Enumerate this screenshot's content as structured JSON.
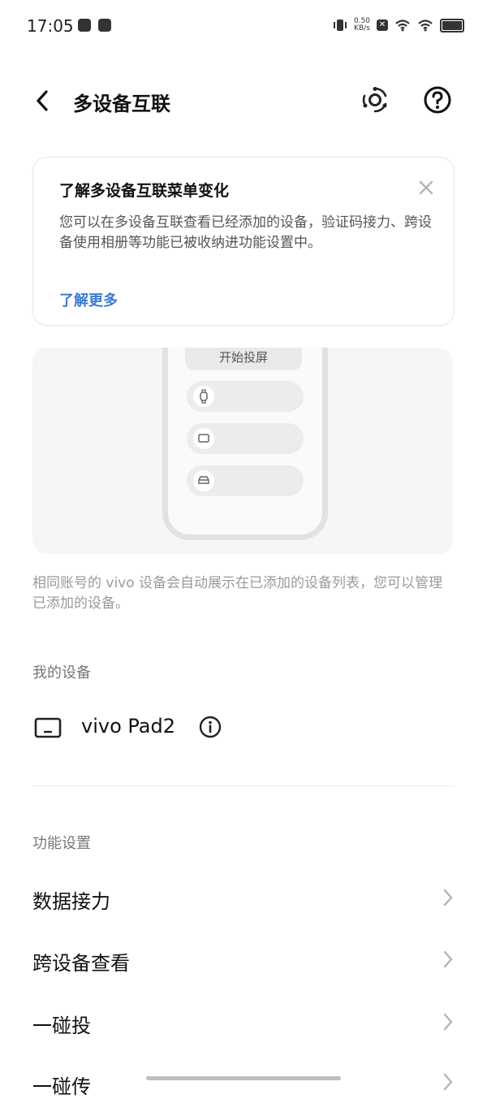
{
  "status_bar": {
    "time": "17:05",
    "net_speed_value": "0.50",
    "net_speed_unit": "KB/s",
    "x_badge": "✕"
  },
  "header": {
    "title": "多设备互联",
    "back_icon": "chevron-left-icon",
    "hub_icon": "device-hub-icon",
    "help_icon": "help-icon"
  },
  "info_card": {
    "title": "了解多设备互联菜单变化",
    "body": "您可以在多设备互联查看已经添加的设备，验证码接力、跨设备使用相册等功能已被收纳进功能设置中。",
    "link": "了解更多",
    "link_color": "#3b7bd1"
  },
  "illustration": {
    "cast_button": "开始投屏",
    "pill_icons": [
      "watch-icon",
      "tablet-icon",
      "car-icon"
    ]
  },
  "description": "相同账号的 vivo 设备会自动展示在已添加的设备列表，您可以管理已添加的设备。",
  "my_devices": {
    "label": "我的设备",
    "devices": [
      {
        "name": "vivo Pad2",
        "icon": "tablet-icon"
      }
    ]
  },
  "feature_settings": {
    "label": "功能设置",
    "items": [
      {
        "label": "数据接力"
      },
      {
        "label": "跨设备查看"
      },
      {
        "label": "一碰投"
      },
      {
        "label": "一碰传"
      }
    ]
  }
}
